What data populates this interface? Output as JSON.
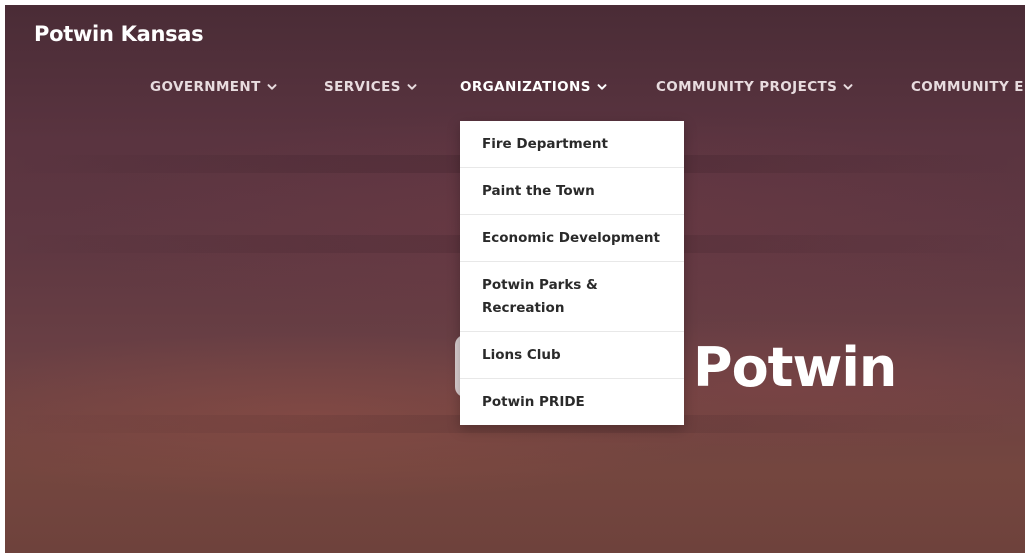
{
  "site": {
    "title": "Potwin Kansas"
  },
  "nav": {
    "items": [
      {
        "label": "GOVERNMENT"
      },
      {
        "label": "SERVICES"
      },
      {
        "label": "ORGANIZATIONS"
      },
      {
        "label": "COMMUNITY PROJECTS"
      },
      {
        "label": "COMMUNITY E"
      }
    ],
    "active_index": 2
  },
  "dropdown": {
    "items": [
      {
        "label": "Fire Department"
      },
      {
        "label": "Paint the Town"
      },
      {
        "label": "Economic Development"
      },
      {
        "label": "Potwin Parks & Recreation"
      },
      {
        "label": "Lions Club"
      },
      {
        "label": "Potwin PRIDE"
      }
    ]
  },
  "hero": {
    "title_visible": "Potwin"
  },
  "icons": {
    "nav_dropdown": "chevron-down-icon"
  },
  "colors": {
    "background_top": "#4a2c36",
    "background_bottom": "#74463f",
    "nav_text": "#e8dcdf",
    "dropdown_bg": "#ffffff",
    "dropdown_text": "#2a2a2a"
  }
}
